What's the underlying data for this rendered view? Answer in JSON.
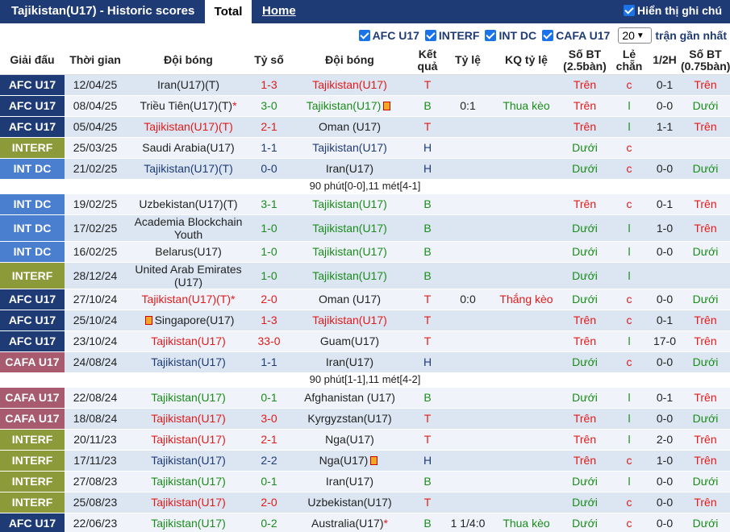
{
  "header": {
    "title": "Tajikistan(U17) - Historic scores",
    "tab_total": "Total",
    "tab_home": "Home",
    "show_label": "Hiển thị ghi chú"
  },
  "filters": {
    "items": [
      "AFC U17",
      "INTERF",
      "INT DC",
      "CAFA U17"
    ],
    "count_value": "20",
    "recent_label": "trận gần nhất"
  },
  "columns": [
    "Giải đấu",
    "Thời gian",
    "Đội bóng",
    "Tỷ số",
    "Đội bóng",
    "Kết quả",
    "Tỷ lệ",
    "KQ tỷ lệ",
    "Số BT (2.5bàn)",
    "Lẻ chẵn",
    "1/2H",
    "Số BT (0.75bàn)"
  ],
  "colors": {
    "header_bg": "#1f3b75",
    "afc": "#1f3b75",
    "interf": "#8c9a3a",
    "intdc": "#4a7fd0",
    "cafa": "#a85a6e",
    "win": "#1a8c1a",
    "loss": "#e21a1a",
    "draw": "#1f3b75"
  },
  "rows": [
    {
      "league": "AFC U17",
      "lc": "afc",
      "date": "12/04/25",
      "home": "Iran(U17)(T)",
      "hc": "blk",
      "score": "1-3",
      "away": "Tajikistan(U17)",
      "ac": "red",
      "res": "T",
      "rc": "red",
      "odds": "",
      "kq": "",
      "kqc": "",
      "bt": "Trên",
      "btc": "red",
      "lc2": "c",
      "lcc": "red",
      "half": "0-1",
      "bt2": "Trên",
      "bt2c": "red"
    },
    {
      "league": "AFC U17",
      "lc": "afc",
      "date": "08/04/25",
      "home": "Triều Tiên(U17)(T)",
      "hc": "blk",
      "homestar": "*",
      "score": "3-0",
      "away": "Tajikistan(U17)",
      "ac": "green",
      "awaycard": true,
      "res": "B",
      "rc": "green",
      "odds": "0:1",
      "kq": "Thua kèo",
      "kqc": "green",
      "bt": "Trên",
      "btc": "red",
      "lc2": "l",
      "lcc": "green",
      "half": "0-0",
      "bt2": "Dưới",
      "bt2c": "green"
    },
    {
      "league": "AFC U17",
      "lc": "afc",
      "date": "05/04/25",
      "home": "Tajikistan(U17)(T)",
      "hc": "red",
      "score": "2-1",
      "away": "Oman (U17)",
      "ac": "blk",
      "res": "T",
      "rc": "red",
      "odds": "",
      "kq": "",
      "kqc": "",
      "bt": "Trên",
      "btc": "red",
      "lc2": "l",
      "lcc": "green",
      "half": "1-1",
      "bt2": "Trên",
      "bt2c": "red"
    },
    {
      "league": "INTERF",
      "lc": "interf",
      "date": "25/03/25",
      "home": "Saudi Arabia(U17)",
      "hc": "blk",
      "score": "1-1",
      "away": "Tajikistan(U17)",
      "ac": "blue",
      "res": "H",
      "rc": "blue",
      "odds": "",
      "kq": "",
      "kqc": "",
      "bt": "Dưới",
      "btc": "green",
      "lc2": "c",
      "lcc": "red",
      "half": "",
      "bt2": "",
      "bt2c": ""
    },
    {
      "league": "INT DC",
      "lc": "intdc",
      "date": "21/02/25",
      "home": "Tajikistan(U17)(T)",
      "hc": "blue",
      "score": "0-0",
      "away": "Iran(U17)",
      "ac": "blk",
      "res": "H",
      "rc": "blue",
      "odds": "",
      "kq": "",
      "kqc": "",
      "bt": "Dưới",
      "btc": "green",
      "lc2": "c",
      "lcc": "red",
      "half": "0-0",
      "bt2": "Dưới",
      "bt2c": "green",
      "note": "90 phút[0-0],11 mét[4-1]"
    },
    {
      "league": "INT DC",
      "lc": "intdc",
      "date": "19/02/25",
      "home": "Uzbekistan(U17)(T)",
      "hc": "blk",
      "score": "3-1",
      "away": "Tajikistan(U17)",
      "ac": "green",
      "res": "B",
      "rc": "green",
      "odds": "",
      "kq": "",
      "kqc": "",
      "bt": "Trên",
      "btc": "red",
      "lc2": "c",
      "lcc": "red",
      "half": "0-1",
      "bt2": "Trên",
      "bt2c": "red"
    },
    {
      "league": "INT DC",
      "lc": "intdc",
      "date": "17/02/25",
      "home": "Academia Blockchain Youth",
      "hc": "blk",
      "tall": true,
      "score": "1-0",
      "away": "Tajikistan(U17)",
      "ac": "green",
      "res": "B",
      "rc": "green",
      "odds": "",
      "kq": "",
      "kqc": "",
      "bt": "Dưới",
      "btc": "green",
      "lc2": "l",
      "lcc": "green",
      "half": "1-0",
      "bt2": "Trên",
      "bt2c": "red"
    },
    {
      "league": "INT DC",
      "lc": "intdc",
      "date": "16/02/25",
      "home": "Belarus(U17)",
      "hc": "blk",
      "score": "1-0",
      "away": "Tajikistan(U17)",
      "ac": "green",
      "res": "B",
      "rc": "green",
      "odds": "",
      "kq": "",
      "kqc": "",
      "bt": "Dưới",
      "btc": "green",
      "lc2": "l",
      "lcc": "green",
      "half": "0-0",
      "bt2": "Dưới",
      "bt2c": "green"
    },
    {
      "league": "INTERF",
      "lc": "interf",
      "date": "28/12/24",
      "home": "United Arab Emirates (U17)",
      "hc": "blk",
      "tall": true,
      "score": "1-0",
      "away": "Tajikistan(U17)",
      "ac": "green",
      "res": "B",
      "rc": "green",
      "odds": "",
      "kq": "",
      "kqc": "",
      "bt": "Dưới",
      "btc": "green",
      "lc2": "l",
      "lcc": "green",
      "half": "",
      "bt2": "",
      "bt2c": ""
    },
    {
      "league": "AFC U17",
      "lc": "afc",
      "date": "27/10/24",
      "home": "Tajikistan(U17)(T)",
      "hc": "red",
      "homestar": "*",
      "score": "2-0",
      "away": "Oman (U17)",
      "ac": "blk",
      "res": "T",
      "rc": "red",
      "odds": "0:0",
      "kq": "Thắng kèo",
      "kqc": "red",
      "bt": "Dưới",
      "btc": "green",
      "lc2": "c",
      "lcc": "red",
      "half": "0-0",
      "bt2": "Dưới",
      "bt2c": "green"
    },
    {
      "league": "AFC U17",
      "lc": "afc",
      "date": "25/10/24",
      "home": "Singapore(U17)",
      "hc": "blk",
      "homecard": true,
      "score": "1-3",
      "away": "Tajikistan(U17)",
      "ac": "red",
      "res": "T",
      "rc": "red",
      "odds": "",
      "kq": "",
      "kqc": "",
      "bt": "Trên",
      "btc": "red",
      "lc2": "c",
      "lcc": "red",
      "half": "0-1",
      "bt2": "Trên",
      "bt2c": "red"
    },
    {
      "league": "AFC U17",
      "lc": "afc",
      "date": "23/10/24",
      "home": "Tajikistan(U17)",
      "hc": "red",
      "score": "33-0",
      "away": "Guam(U17)",
      "ac": "blk",
      "res": "T",
      "rc": "red",
      "odds": "",
      "kq": "",
      "kqc": "",
      "bt": "Trên",
      "btc": "red",
      "lc2": "l",
      "lcc": "green",
      "half": "17-0",
      "bt2": "Trên",
      "bt2c": "red"
    },
    {
      "league": "CAFA U17",
      "lc": "cafa",
      "date": "24/08/24",
      "home": "Tajikistan(U17)",
      "hc": "blue",
      "score": "1-1",
      "away": "Iran(U17)",
      "ac": "blk",
      "res": "H",
      "rc": "blue",
      "odds": "",
      "kq": "",
      "kqc": "",
      "bt": "Dưới",
      "btc": "green",
      "lc2": "c",
      "lcc": "red",
      "half": "0-0",
      "bt2": "Dưới",
      "bt2c": "green",
      "note": "90 phút[1-1],11 mét[4-2]"
    },
    {
      "league": "CAFA U17",
      "lc": "cafa",
      "date": "22/08/24",
      "home": "Tajikistan(U17)",
      "hc": "green",
      "score": "0-1",
      "away": "Afghanistan (U17)",
      "ac": "blk",
      "res": "B",
      "rc": "green",
      "odds": "",
      "kq": "",
      "kqc": "",
      "bt": "Dưới",
      "btc": "green",
      "lc2": "l",
      "lcc": "green",
      "half": "0-1",
      "bt2": "Trên",
      "bt2c": "red"
    },
    {
      "league": "CAFA U17",
      "lc": "cafa",
      "date": "18/08/24",
      "home": "Tajikistan(U17)",
      "hc": "red",
      "score": "3-0",
      "away": "Kyrgyzstan(U17)",
      "ac": "blk",
      "res": "T",
      "rc": "red",
      "odds": "",
      "kq": "",
      "kqc": "",
      "bt": "Trên",
      "btc": "red",
      "lc2": "l",
      "lcc": "green",
      "half": "0-0",
      "bt2": "Dưới",
      "bt2c": "green"
    },
    {
      "league": "INTERF",
      "lc": "interf",
      "date": "20/11/23",
      "home": "Tajikistan(U17)",
      "hc": "red",
      "score": "2-1",
      "away": "Nga(U17)",
      "ac": "blk",
      "res": "T",
      "rc": "red",
      "odds": "",
      "kq": "",
      "kqc": "",
      "bt": "Trên",
      "btc": "red",
      "lc2": "l",
      "lcc": "green",
      "half": "2-0",
      "bt2": "Trên",
      "bt2c": "red"
    },
    {
      "league": "INTERF",
      "lc": "interf",
      "date": "17/11/23",
      "home": "Tajikistan(U17)",
      "hc": "blue",
      "score": "2-2",
      "away": "Nga(U17)",
      "ac": "blk",
      "awaycard": true,
      "res": "H",
      "rc": "blue",
      "odds": "",
      "kq": "",
      "kqc": "",
      "bt": "Trên",
      "btc": "red",
      "lc2": "c",
      "lcc": "red",
      "half": "1-0",
      "bt2": "Trên",
      "bt2c": "red"
    },
    {
      "league": "INTERF",
      "lc": "interf",
      "date": "27/08/23",
      "home": "Tajikistan(U17)",
      "hc": "green",
      "score": "0-1",
      "away": "Iran(U17)",
      "ac": "blk",
      "res": "B",
      "rc": "green",
      "odds": "",
      "kq": "",
      "kqc": "",
      "bt": "Dưới",
      "btc": "green",
      "lc2": "l",
      "lcc": "green",
      "half": "0-0",
      "bt2": "Dưới",
      "bt2c": "green"
    },
    {
      "league": "INTERF",
      "lc": "interf",
      "date": "25/08/23",
      "home": "Tajikistan(U17)",
      "hc": "red",
      "score": "2-0",
      "away": "Uzbekistan(U17)",
      "ac": "blk",
      "res": "T",
      "rc": "red",
      "odds": "",
      "kq": "",
      "kqc": "",
      "bt": "Dưới",
      "btc": "green",
      "lc2": "c",
      "lcc": "red",
      "half": "0-0",
      "bt2": "Trên",
      "bt2c": "red"
    },
    {
      "league": "AFC U17",
      "lc": "afc",
      "date": "22/06/23",
      "home": "Tajikistan(U17)",
      "hc": "green",
      "score": "0-2",
      "away": "Australia(U17)",
      "ac": "blk",
      "awaystar": "*",
      "res": "B",
      "rc": "green",
      "odds": "1 1/4:0",
      "kq": "Thua kèo",
      "kqc": "green",
      "bt": "Dưới",
      "btc": "green",
      "lc2": "c",
      "lcc": "red",
      "half": "0-0",
      "bt2": "Dưới",
      "bt2c": "green"
    }
  ]
}
